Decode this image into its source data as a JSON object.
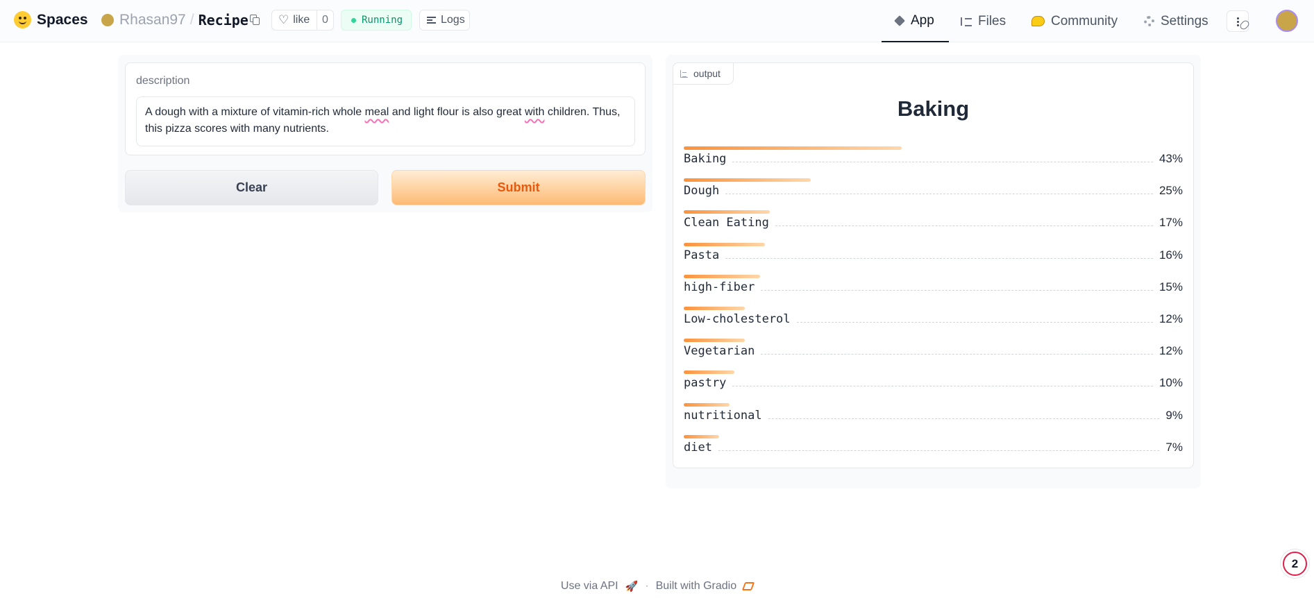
{
  "header": {
    "brand": "Spaces",
    "owner": "Rhasan97",
    "separator": "/",
    "repo": "Recipe",
    "like_label": "like",
    "like_count": "0",
    "status": "Running",
    "logs_label": "Logs",
    "tabs": [
      {
        "label": "App",
        "icon": "cube-icon",
        "active": true
      },
      {
        "label": "Files",
        "icon": "files-icon",
        "active": false
      },
      {
        "label": "Community",
        "icon": "community-icon",
        "active": false
      },
      {
        "label": "Settings",
        "icon": "gear-icon",
        "active": false
      }
    ]
  },
  "input": {
    "label": "description",
    "text_parts": [
      "A dough with a mixture of vitamin-rich whole ",
      "meal",
      " and light flour is also great ",
      "with",
      " children. Thus, this pizza scores with many nutrients."
    ]
  },
  "buttons": {
    "clear": "Clear",
    "submit": "Submit"
  },
  "output": {
    "tag": "output",
    "title": "Baking",
    "labels": [
      {
        "name": "Baking",
        "percent": "43%",
        "value": 0.43
      },
      {
        "name": "Dough",
        "percent": "25%",
        "value": 0.25
      },
      {
        "name": "Clean Eating",
        "percent": "17%",
        "value": 0.17
      },
      {
        "name": "Pasta",
        "percent": "16%",
        "value": 0.16
      },
      {
        "name": "high-fiber",
        "percent": "15%",
        "value": 0.15
      },
      {
        "name": "Low-cholesterol",
        "percent": "12%",
        "value": 0.12
      },
      {
        "name": "Vegetarian",
        "percent": "12%",
        "value": 0.12
      },
      {
        "name": "pastry",
        "percent": "10%",
        "value": 0.1
      },
      {
        "name": "nutritional",
        "percent": "9%",
        "value": 0.09
      },
      {
        "name": "diet",
        "percent": "7%",
        "value": 0.07
      }
    ]
  },
  "footer": {
    "api": "Use via API",
    "separator": "·",
    "built": "Built with Gradio"
  },
  "notification_count": "2",
  "colors": {
    "accent": "#ea580c",
    "bar_start": "#fb923c",
    "bar_end": "#fed7aa",
    "running": "#059669"
  }
}
